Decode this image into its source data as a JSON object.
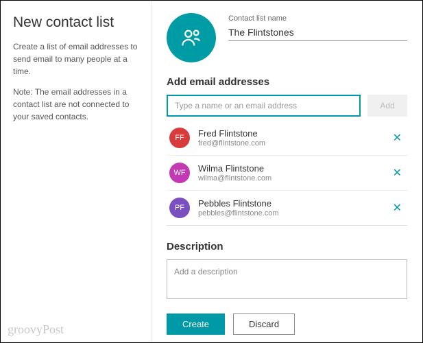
{
  "left": {
    "title": "New contact list",
    "desc1": "Create a list of email addresses to send email to many people at a time.",
    "desc2": "Note: The email addresses in a contact list are not connected to your saved contacts."
  },
  "name_field": {
    "label": "Contact list name",
    "value": "The Flintstones"
  },
  "add_section": {
    "title": "Add email addresses",
    "placeholder": "Type a name or an email address",
    "add_label": "Add"
  },
  "contacts": [
    {
      "initials": "FF",
      "color": "#d83b3b",
      "name": "Fred Flintstone",
      "email": "fred@flintstone.com"
    },
    {
      "initials": "WF",
      "color": "#c239b3",
      "name": "Wilma Flintstone",
      "email": "wilma@flintstone.com"
    },
    {
      "initials": "PF",
      "color": "#7a4fbf",
      "name": "Pebbles Flintstone",
      "email": "pebbles@flintstone.com"
    }
  ],
  "description": {
    "title": "Description",
    "placeholder": "Add a description"
  },
  "buttons": {
    "create": "Create",
    "discard": "Discard"
  },
  "watermark": "groovyPost"
}
